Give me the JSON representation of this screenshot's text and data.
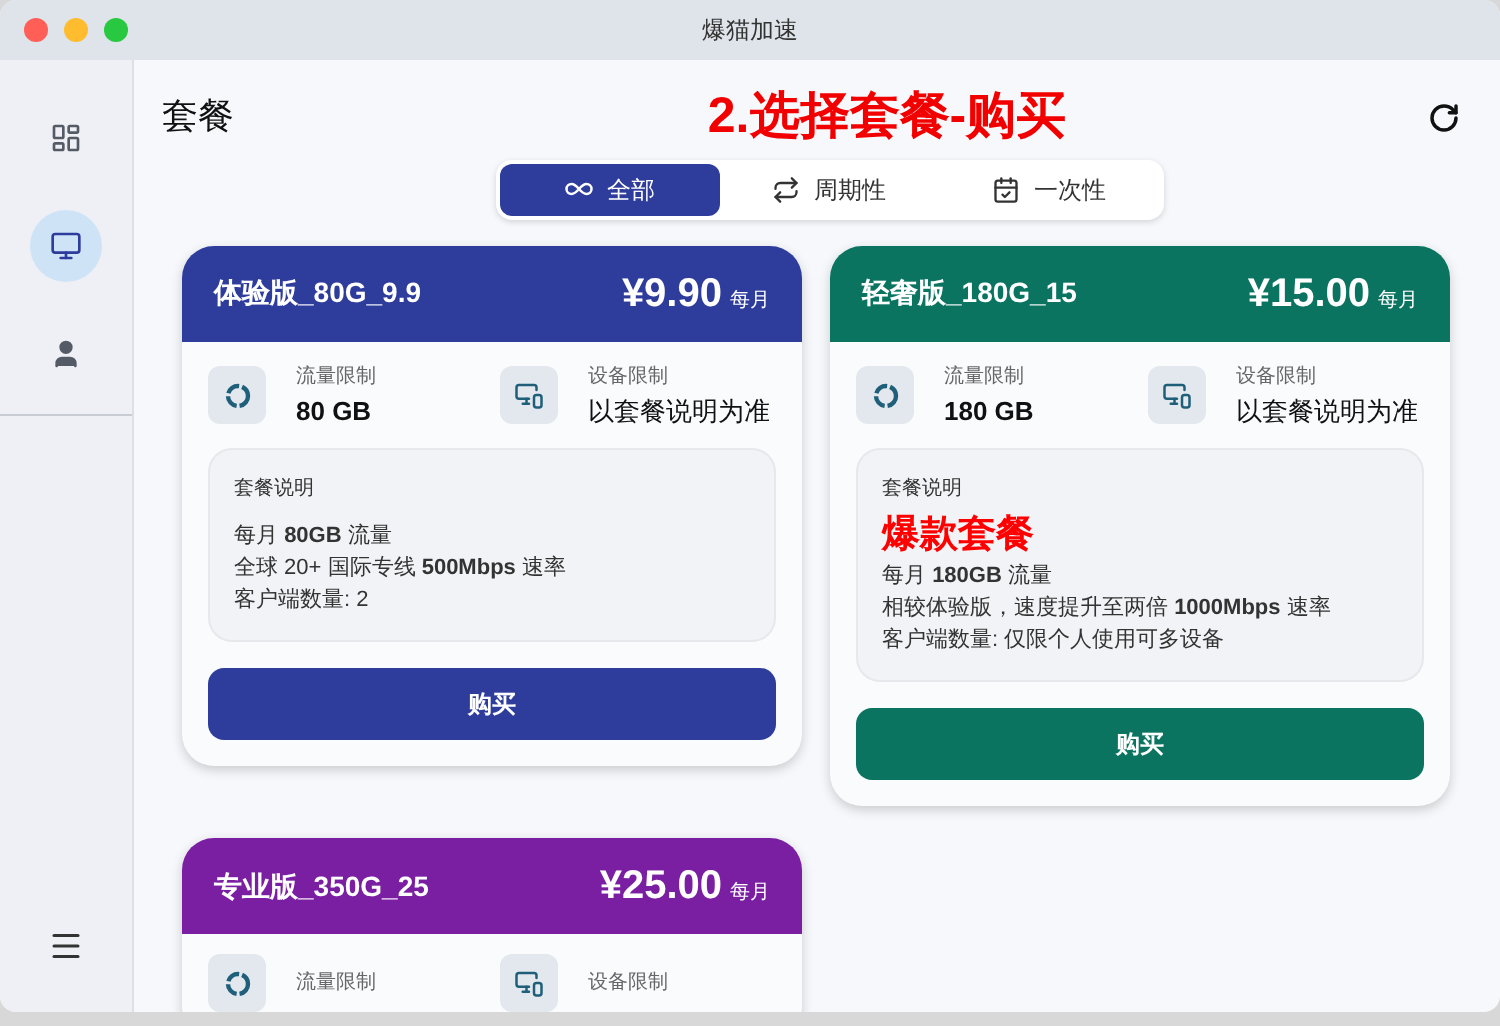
{
  "window": {
    "title": "爆猫加速"
  },
  "sidebar": {
    "items": [
      {
        "kind": "dashboard",
        "selected": false
      },
      {
        "kind": "plans",
        "selected": true
      },
      {
        "kind": "user",
        "selected": false
      }
    ]
  },
  "page": {
    "title": "套餐",
    "annotation": "2.选择套餐-购买"
  },
  "tabs": [
    {
      "kind": "all",
      "label": "全部",
      "selected": true
    },
    {
      "kind": "periodic",
      "label": "周期性",
      "selected": false
    },
    {
      "kind": "once",
      "label": "一次性",
      "selected": false
    }
  ],
  "plans": [
    {
      "name": "体验版_80G_9.9",
      "price": "¥9.90",
      "period": "每月",
      "color": "#2e3d9c",
      "traffic_label": "流量限制",
      "traffic": "80 GB",
      "device_label": "设备限制",
      "device": "以套餐说明为准",
      "desc_title": "套餐说明",
      "lines": [
        "每月 **80GB** 流量",
        "全球 20+ 国际专线 **500Mbps** 速率",
        "客户端数量: 2"
      ],
      "button": "购买"
    },
    {
      "name": "轻奢版_180G_15",
      "price": "¥15.00",
      "period": "每月",
      "color": "#0a7461",
      "traffic_label": "流量限制",
      "traffic": "180 GB",
      "device_label": "设备限制",
      "device": "以套餐说明为准",
      "desc_title": "套餐说明",
      "highlight": "爆款套餐",
      "lines": [
        "每月 **180GB** 流量",
        "相较体验版，速度提升至两倍 **1000Mbps** 速率",
        "客户端数量: 仅限个人使用可多设备"
      ],
      "button": "购买"
    },
    {
      "name": "专业版_350G_25",
      "price": "¥25.00",
      "period": "每月",
      "color": "#7b1fa2",
      "traffic_label": "流量限制",
      "device_label": "设备限制"
    }
  ]
}
